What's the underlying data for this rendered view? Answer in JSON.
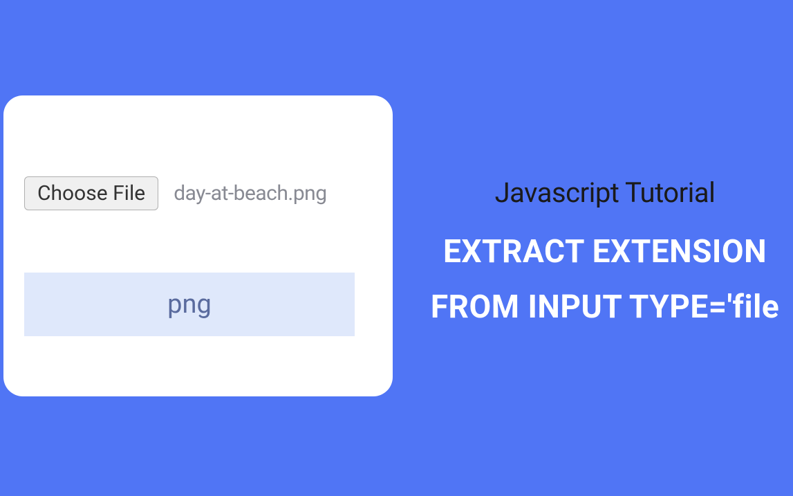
{
  "card": {
    "choose_file_label": "Choose File",
    "filename": "day-at-beach.png",
    "result": "png"
  },
  "title": {
    "subtitle": "Javascript Tutorial",
    "line1": "EXTRACT EXTENSION",
    "line2": "FROM INPUT TYPE='file"
  }
}
